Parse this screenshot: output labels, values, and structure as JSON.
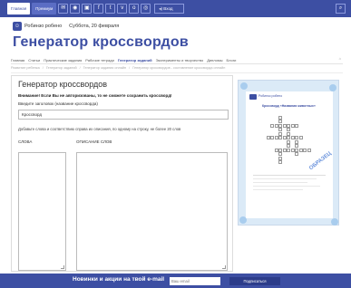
{
  "topbar": {
    "tabs": [
      {
        "label": "Главная",
        "active": true
      },
      {
        "label": "Премиум",
        "active": false
      }
    ],
    "icons": [
      "mail-icon",
      "rss-icon",
      "bookmark-icon",
      "facebook-icon",
      "twitter-icon",
      "vk-icon",
      "odnoklassniki-icon",
      "instagram-icon"
    ],
    "vk_label": "Вход"
  },
  "subheader": {
    "site_name": "Робинзо робено",
    "date": "Суббота, 20 февраля"
  },
  "page_title": "Генератор кроссвордов",
  "menu": {
    "items": [
      {
        "label": "Главная",
        "selected": false
      },
      {
        "label": "Статьи",
        "selected": false
      },
      {
        "label": "Практические задания",
        "selected": false
      },
      {
        "label": "Рабочие тетради",
        "selected": false
      },
      {
        "label": "Генератор заданий",
        "selected": true
      },
      {
        "label": "Эксперименты и творчество",
        "selected": false
      },
      {
        "label": "Дипломы",
        "selected": false
      },
      {
        "label": "Блоги",
        "selected": false
      }
    ]
  },
  "breadcrumb": [
    "Развитие ребенка",
    "Генератор заданий",
    "Генератор задания онлайн",
    "Генератор кроссвордов - составление кроссворда онлайн"
  ],
  "generator": {
    "title": "Генератор кроссвордов",
    "warning": "Внимание! Если Вы не авторизованы, то не сможете сохранить кроссворд!",
    "title_label": "Введите заголовок (название кроссворда)",
    "title_value": "Кроссворд",
    "instructions": "Добавьте слова и соответствию справа их описания, по одному на строку, не более 20 слов",
    "col_words": "СЛОВА",
    "col_descriptions": "ОПИСАНИЕ СЛОВ"
  },
  "preview": {
    "site": "Робинзо робено",
    "sheet_title": "Кроссворд «Названия животных»",
    "watermark": "ОБРАЗЕЦ"
  },
  "footer": {
    "text": "Новинки и акции на твой e-mail",
    "email_placeholder": "Ваш email",
    "subscribe_label": "Подписаться"
  },
  "colors": {
    "brand": "#3d4fa3",
    "preview_bg": "#dbeaf7"
  }
}
